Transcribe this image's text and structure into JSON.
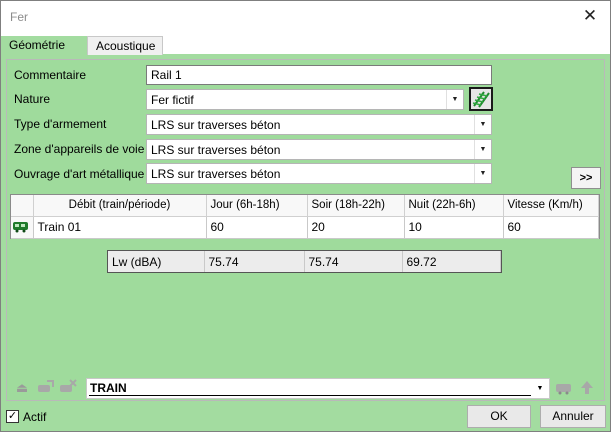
{
  "window": {
    "title": "Fer",
    "close_glyph": "✕"
  },
  "tabs": [
    {
      "label": "Géométrie"
    },
    {
      "label": "Acoustique"
    }
  ],
  "form": {
    "commentaire_label": "Commentaire",
    "commentaire_value": "Rail 1",
    "nature_label": "Nature",
    "nature_value": "Fer fictif",
    "armement_label": "Type d'armement",
    "armement_value": "LRS sur traverses béton",
    "zone_label": "Zone d'appareils de voie",
    "zone_value": "LRS sur traverses béton",
    "ouvrage_label": "Ouvrage d'art métallique",
    "ouvrage_value": "LRS sur traverses béton",
    "more_label": ">>"
  },
  "traffic_table": {
    "headers": [
      "Débit (train/période)",
      "Jour (6h-18h)",
      "Soir (18h-22h)",
      "Nuit (22h-6h)",
      "Vitesse (Km/h)"
    ],
    "rows": [
      {
        "name": "Train 01",
        "jour": "60",
        "soir": "20",
        "nuit": "10",
        "vitesse": "60"
      }
    ]
  },
  "lw": {
    "label": "Lw (dBA)",
    "jour": "75.74",
    "soir": "75.74",
    "nuit": "69.72"
  },
  "bottom": {
    "selector_value": "TRAIN"
  },
  "footer": {
    "actif_label": "Actif",
    "actif_checked": "✓",
    "ok_label": "OK",
    "cancel_label": "Annuler"
  },
  "icons": {
    "nature_button": "rail-track-icon",
    "row_icon": "train-icon",
    "bottom_left": [
      "eject-icon",
      "train-edit-icon",
      "train-delete-icon"
    ],
    "bottom_right": [
      "train-icon",
      "arrow-up-icon"
    ]
  },
  "colors": {
    "background": "#a3dca0",
    "accent": "#1f8a2e"
  }
}
